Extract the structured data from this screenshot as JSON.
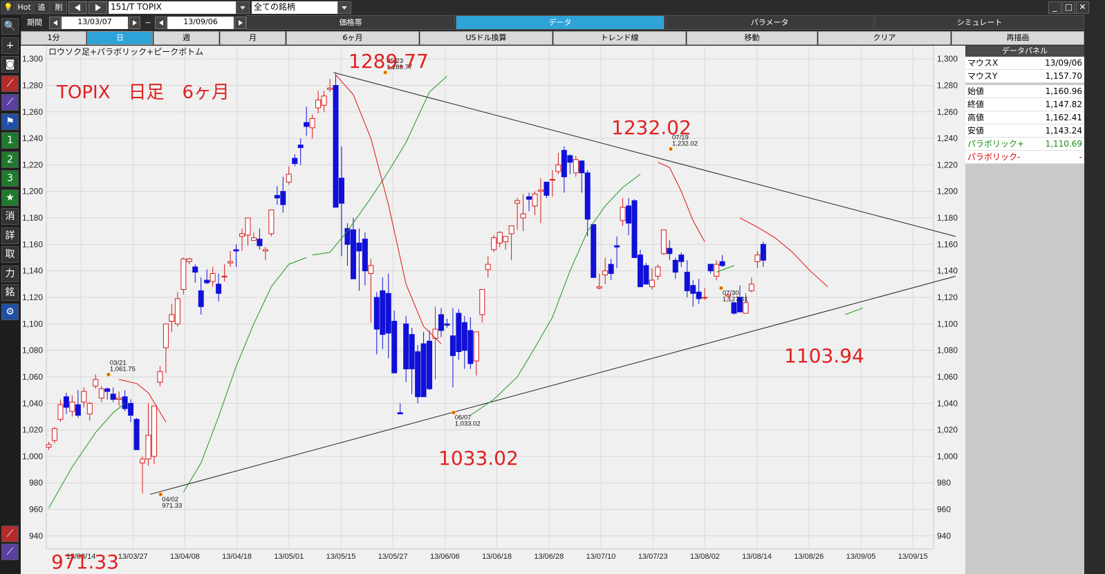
{
  "toolbar": {
    "hot": "Hot",
    "add": "追",
    "remove": "削",
    "symbol": "151/T TOPIX",
    "list": "全ての銘柄"
  },
  "period": {
    "label": "期間",
    "start": "13/03/07",
    "sep": "~",
    "end": "13/09/06"
  },
  "tabs": [
    {
      "label": "価格帯",
      "active": false
    },
    {
      "label": "データ",
      "active": true
    },
    {
      "label": "パラメータ",
      "active": false
    },
    {
      "label": "シミュレート",
      "active": false
    }
  ],
  "timeframes": [
    {
      "label": "1分",
      "active": false
    },
    {
      "label": "日",
      "active": true
    },
    {
      "label": "週",
      "active": false
    },
    {
      "label": "月",
      "active": false
    },
    {
      "label": "6ヶ月",
      "active": false
    }
  ],
  "actions": [
    "USドル換算",
    "トレンド線",
    "移動",
    "クリア",
    "再描画"
  ],
  "left_tools": [
    {
      "icon": "magnifier-icon",
      "glyph": "🔍",
      "style": ""
    },
    {
      "icon": "plus-icon",
      "glyph": "+",
      "style": ""
    },
    {
      "icon": "camera-icon",
      "glyph": "◙",
      "style": ""
    },
    {
      "icon": "line-chart-red-icon",
      "glyph": "⟋",
      "style": "red"
    },
    {
      "icon": "line-chart-purple-icon",
      "glyph": "⟋",
      "style": "purple"
    },
    {
      "icon": "flag-icon",
      "glyph": "⚑",
      "style": "blue"
    },
    {
      "icon": "one-icon",
      "glyph": "1",
      "style": "green"
    },
    {
      "icon": "two-icon",
      "glyph": "2",
      "style": "green"
    },
    {
      "icon": "three-icon",
      "glyph": "3",
      "style": "green"
    },
    {
      "icon": "star-icon",
      "glyph": "★",
      "style": "green"
    },
    {
      "icon": "erase-icon",
      "glyph": "消",
      "style": ""
    },
    {
      "icon": "detail-icon",
      "glyph": "詳",
      "style": ""
    },
    {
      "icon": "trade-icon",
      "glyph": "取",
      "style": ""
    },
    {
      "icon": "power-icon",
      "glyph": "力",
      "style": ""
    },
    {
      "icon": "brand-icon",
      "glyph": "銘",
      "style": ""
    },
    {
      "icon": "settings-icon",
      "glyph": "⚙",
      "style": "blue"
    }
  ],
  "panel": {
    "title": "データパネル",
    "rows": [
      {
        "label": "マウスX",
        "value": "13/09/06",
        "color": "#000"
      },
      {
        "label": "マウスY",
        "value": "1,157.70",
        "color": "#000"
      },
      {
        "label": "始値",
        "value": "1,160.96",
        "color": "#000"
      },
      {
        "label": "終値",
        "value": "1,147.82",
        "color": "#000"
      },
      {
        "label": "高値",
        "value": "1,162.41",
        "color": "#000"
      },
      {
        "label": "安値",
        "value": "1,143.24",
        "color": "#000"
      },
      {
        "label": "パラボリック+",
        "value": "1,110.69",
        "color": "#1a8a1a"
      },
      {
        "label": "パラボリック-",
        "value": "-",
        "color": "#d00000"
      }
    ]
  },
  "chart_data": {
    "type": "candlestick",
    "subtitle": "ロウソク足+パラボリック+ピークボトム",
    "title": "TOPIX　日足　6ヶ月",
    "ylim": [
      930,
      1310
    ],
    "yticks": [
      "1,300",
      "1,280",
      "1,260",
      "1,240",
      "1,220",
      "1,200",
      "1,180",
      "1,160",
      "1,140",
      "1,120",
      "1,100",
      "1,080",
      "1,060",
      "1,040",
      "1,020",
      "1,000",
      "980",
      "960",
      "940"
    ],
    "ytick_values": [
      1300,
      1280,
      1260,
      1240,
      1220,
      1200,
      1180,
      1160,
      1140,
      1120,
      1100,
      1080,
      1060,
      1040,
      1020,
      1000,
      980,
      960,
      940
    ],
    "x_labels": [
      "13/03/14",
      "13/03/27",
      "13/04/08",
      "13/04/18",
      "13/05/01",
      "13/05/15",
      "13/05/27",
      "13/06/06",
      "13/06/18",
      "13/06/28",
      "13/07/10",
      "13/07/23",
      "13/08/02",
      "13/08/14",
      "13/08/26",
      "13/09/05",
      "13/09/15"
    ],
    "peaks": [
      {
        "date": "03/21",
        "value": "1,061.75",
        "big": ""
      },
      {
        "date": "04/02",
        "value": "971.33",
        "big": "971.33"
      },
      {
        "date": "05/23",
        "value": "1,289.77",
        "big": "1289.77"
      },
      {
        "date": "06/07",
        "value": "1,033.02",
        "big": "1033.02"
      },
      {
        "date": "07/19",
        "value": "1,232.02",
        "big": "1232.02"
      },
      {
        "date": "07/30",
        "value": "1,127.01",
        "big": ""
      }
    ],
    "annotation_extra": "1103.94",
    "colors": {
      "up": "#d81818",
      "down": "#1010d8",
      "sar_plus": "#1a9a1a",
      "sar_minus": "#e01010",
      "trend": "#202020"
    },
    "candles": [
      [
        1007,
        1011,
        1005,
        1009
      ],
      [
        1012,
        1022,
        1010,
        1021
      ],
      [
        1028,
        1043,
        1026,
        1039
      ],
      [
        1045,
        1048,
        1032,
        1037
      ],
      [
        1034,
        1046,
        1030,
        1041
      ],
      [
        1039,
        1050,
        1029,
        1031
      ],
      [
        1041,
        1052,
        1037,
        1049
      ],
      [
        1032,
        1041,
        1027,
        1040
      ],
      [
        1053,
        1062,
        1051,
        1058
      ],
      [
        1044,
        1053,
        1041,
        1051
      ],
      [
        1051,
        1052,
        1043,
        1049
      ],
      [
        1047,
        1052,
        1041,
        1043
      ],
      [
        1043,
        1049,
        1038,
        1044
      ],
      [
        1045,
        1050,
        1034,
        1036
      ],
      [
        1040,
        1043,
        1026,
        1031
      ],
      [
        1028,
        1029,
        1007,
        1005
      ],
      [
        995,
        1000,
        972,
        998
      ],
      [
        998,
        1040,
        993,
        1016
      ],
      [
        1000,
        1038,
        994,
        1038
      ],
      [
        1056,
        1068,
        1053,
        1064
      ],
      [
        1082,
        1094,
        1063,
        1100
      ],
      [
        1102,
        1115,
        1094,
        1107
      ],
      [
        1100,
        1124,
        1098,
        1119
      ],
      [
        1126,
        1150,
        1122,
        1149
      ],
      [
        1147,
        1150,
        1145,
        1149
      ],
      [
        1143,
        1145,
        1131,
        1139
      ],
      [
        1125,
        1135,
        1107,
        1113
      ],
      [
        1133,
        1141,
        1130,
        1131
      ],
      [
        1132,
        1143,
        1128,
        1138
      ],
      [
        1130,
        1138,
        1117,
        1123
      ],
      [
        1136,
        1145,
        1132,
        1136
      ],
      [
        1146,
        1155,
        1143,
        1147
      ],
      [
        1156,
        1160,
        1143,
        1155
      ],
      [
        1166,
        1172,
        1155,
        1168
      ],
      [
        1167,
        1180,
        1159,
        1180
      ],
      [
        1163,
        1169,
        1163,
        1165
      ],
      [
        1164,
        1172,
        1156,
        1159
      ],
      [
        1155,
        1158,
        1148,
        1156
      ],
      [
        1168,
        1185,
        1166,
        1186
      ],
      [
        1197,
        1204,
        1190,
        1195
      ],
      [
        1200,
        1211,
        1184,
        1190
      ],
      [
        1207,
        1219,
        1205,
        1213
      ],
      [
        1225,
        1228,
        1219,
        1221
      ],
      [
        1235,
        1240,
        1220,
        1233
      ],
      [
        1252,
        1264,
        1242,
        1249
      ],
      [
        1248,
        1258,
        1240,
        1255
      ],
      [
        1263,
        1276,
        1259,
        1269
      ],
      [
        1265,
        1276,
        1260,
        1272
      ],
      [
        1277,
        1285,
        1275,
        1278
      ],
      [
        1280,
        1289,
        1188,
        1188
      ],
      [
        1210,
        1234,
        1151,
        1191
      ],
      [
        1172,
        1176,
        1144,
        1160
      ],
      [
        1171,
        1180,
        1136,
        1134
      ],
      [
        1161,
        1172,
        1125,
        1155
      ],
      [
        1164,
        1169,
        1129,
        1140
      ],
      [
        1138,
        1149,
        1101,
        1144
      ],
      [
        1120,
        1124,
        1077,
        1096
      ],
      [
        1125,
        1135,
        1081,
        1092
      ],
      [
        1123,
        1138,
        1074,
        1093
      ],
      [
        1102,
        1110,
        1068,
        1063
      ],
      [
        1033,
        1040,
        1032,
        1032
      ],
      [
        1100,
        1106,
        1056,
        1066
      ],
      [
        1092,
        1097,
        1047,
        1066
      ],
      [
        1079,
        1084,
        1040,
        1045
      ],
      [
        1085,
        1094,
        1045,
        1045
      ],
      [
        1087,
        1095,
        1050,
        1051
      ],
      [
        1089,
        1113,
        1058,
        1096
      ],
      [
        1107,
        1112,
        1090,
        1095
      ],
      [
        1100,
        1104,
        1097,
        1099
      ],
      [
        1091,
        1112,
        1052,
        1076
      ],
      [
        1108,
        1111,
        1073,
        1079
      ],
      [
        1101,
        1106,
        1066,
        1080
      ],
      [
        1095,
        1105,
        1066,
        1070
      ],
      [
        1072,
        1090,
        1061,
        1094
      ],
      [
        1107,
        1122,
        1101,
        1126
      ],
      [
        1141,
        1151,
        1135,
        1145
      ],
      [
        1156,
        1167,
        1154,
        1165
      ],
      [
        1161,
        1170,
        1158,
        1169
      ],
      [
        1162,
        1166,
        1156,
        1166
      ],
      [
        1168,
        1174,
        1148,
        1174
      ],
      [
        1191,
        1195,
        1171,
        1193
      ],
      [
        1180,
        1198,
        1170,
        1183
      ],
      [
        1196,
        1199,
        1185,
        1194
      ],
      [
        1189,
        1200,
        1182,
        1198
      ],
      [
        1200,
        1210,
        1176,
        1201
      ],
      [
        1207,
        1207,
        1195,
        1197
      ],
      [
        1209,
        1216,
        1196,
        1209
      ],
      [
        1215,
        1229,
        1213,
        1220
      ],
      [
        1231,
        1234,
        1199,
        1211
      ],
      [
        1227,
        1228,
        1213,
        1222
      ],
      [
        1214,
        1227,
        1211,
        1224
      ],
      [
        1223,
        1222,
        1199,
        1214
      ],
      [
        1214,
        1216,
        1166,
        1179
      ],
      [
        1175,
        1175,
        1141,
        1135
      ],
      [
        1127,
        1138,
        1126,
        1128
      ],
      [
        1137,
        1150,
        1130,
        1140
      ],
      [
        1145,
        1149,
        1133,
        1138
      ],
      [
        1159,
        1166,
        1142,
        1158
      ],
      [
        1178,
        1195,
        1174,
        1188
      ],
      [
        1189,
        1195,
        1167,
        1176
      ],
      [
        1193,
        1194,
        1156,
        1150
      ],
      [
        1152,
        1156,
        1138,
        1128
      ],
      [
        1144,
        1146,
        1133,
        1130
      ],
      [
        1128,
        1142,
        1126,
        1133
      ],
      [
        1136,
        1145,
        1133,
        1143
      ],
      [
        1153,
        1168,
        1152,
        1171
      ],
      [
        1157,
        1163,
        1148,
        1153
      ],
      [
        1148,
        1150,
        1134,
        1139
      ],
      [
        1152,
        1154,
        1143,
        1147
      ],
      [
        1139,
        1148,
        1120,
        1125
      ],
      [
        1129,
        1133,
        1113,
        1123
      ],
      [
        1124,
        1134,
        1115,
        1119
      ],
      [
        1120,
        1127,
        1118,
        1120
      ],
      [
        1145,
        1145,
        1138,
        1140
      ],
      [
        1136,
        1148,
        1133,
        1145
      ],
      [
        1147,
        1152,
        1143,
        1144
      ],
      [
        1121,
        1122,
        1118,
        1122
      ],
      [
        1116,
        1116,
        1107,
        1108
      ],
      [
        1120,
        1129,
        1109,
        1109
      ],
      [
        1108,
        1123,
        1113,
        1116
      ],
      [
        1125,
        1135,
        1124,
        1130
      ],
      [
        1147,
        1155,
        1142,
        1152
      ],
      [
        1160,
        1162,
        1143,
        1148
      ]
    ],
    "trendlines": [
      {
        "from": [
          "13/04/02",
          971
        ],
        "to": [
          "13/09/15",
          1136
        ]
      },
      {
        "from": [
          "13/05/23",
          1290
        ],
        "to": [
          "13/09/15",
          1166
        ]
      }
    ]
  }
}
